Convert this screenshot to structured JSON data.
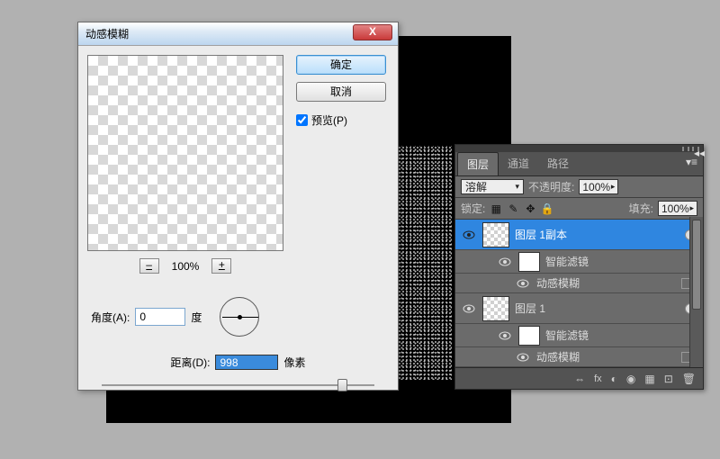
{
  "dialog": {
    "title": "动感模糊",
    "ok": "确定",
    "cancel": "取消",
    "preview_label": "预览(P)",
    "preview_checked": true,
    "zoom_minus": "–",
    "zoom_value": "100%",
    "zoom_plus": "+",
    "angle_label": "角度(A):",
    "angle_value": "0",
    "angle_unit": "度",
    "distance_label": "距离(D):",
    "distance_value": "998",
    "distance_unit": "像素"
  },
  "panel": {
    "tabs": [
      "图层",
      "通道",
      "路径"
    ],
    "active_tab": 0,
    "blend_mode": "溶解",
    "opacity_label": "不透明度:",
    "opacity_value": "100%",
    "lock_label": "锁定:",
    "fill_label": "填充:",
    "fill_value": "100%",
    "layers": [
      {
        "name": "图层 1副本",
        "selected": true,
        "smart": true
      },
      {
        "name": "智能滤镜",
        "sub": true
      },
      {
        "name": "动感模糊",
        "filter": true
      },
      {
        "name": "图层 1",
        "smart": true
      },
      {
        "name": "智能滤镜",
        "sub": true
      },
      {
        "name": "动感模糊",
        "filter": true
      }
    ],
    "footer_icons": [
      "⇔",
      "fx",
      "◐",
      "◉",
      "▦",
      "⊡",
      "🗑"
    ]
  }
}
